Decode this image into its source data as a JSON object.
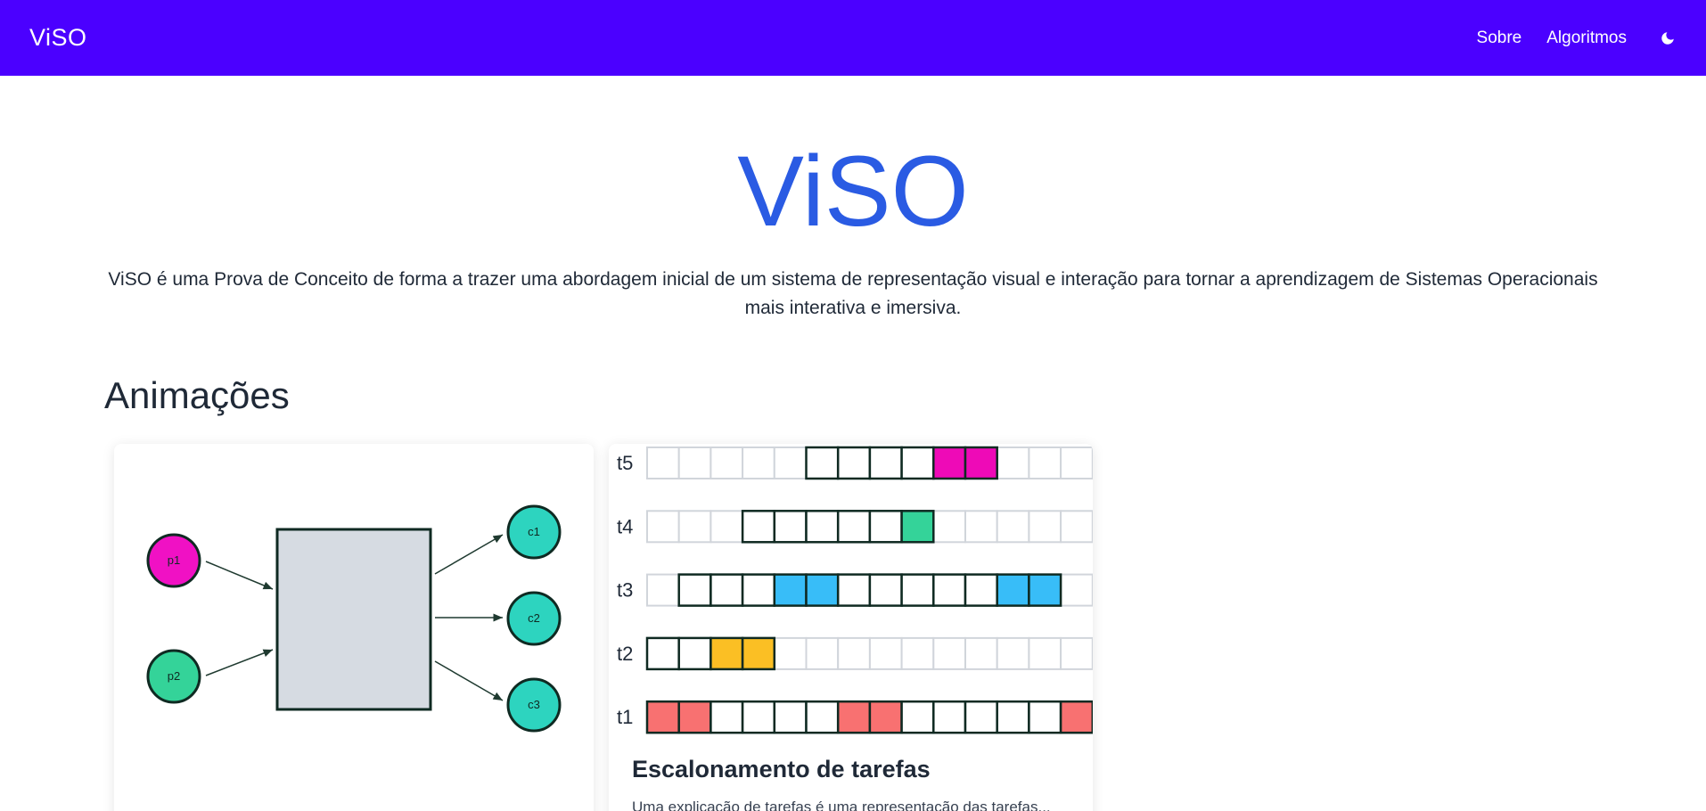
{
  "nav": {
    "brand": "ViSO",
    "links": [
      "Sobre",
      "Algoritmos"
    ],
    "theme_icon": "moon-icon"
  },
  "hero": {
    "title": "ViSO",
    "description": "ViSO é uma Prova de Conceito de forma a trazer uma abordagem inicial de um sistema de representação visual e interação para tornar a aprendizagem de Sistemas Operacionais mais interativa e imersiva."
  },
  "section": {
    "title": "Animações"
  },
  "producer_consumer": {
    "producers": [
      "p1",
      "p2"
    ],
    "consumers": [
      "c1",
      "c2",
      "c3"
    ],
    "colors": {
      "producer_p1": "#f011c4",
      "producer_p2": "#34d399",
      "consumer": "#2dd4bf",
      "buffer": "#d6dbe2"
    }
  },
  "scheduling": {
    "title": "Escalonamento de tarefas",
    "description": "Uma explicação de tarefas é uma representação das tarefas...",
    "rows": [
      {
        "label": "t5",
        "color": "#ee0ab7",
        "cells": [
          "e",
          "e",
          "e",
          "e",
          "e",
          "w",
          "w",
          "w",
          "w",
          "r",
          "r",
          "e",
          "e",
          "e"
        ]
      },
      {
        "label": "t4",
        "color": "#34d399",
        "cells": [
          "e",
          "e",
          "e",
          "w",
          "w",
          "w",
          "w",
          "w",
          "r",
          "e",
          "e",
          "e",
          "e",
          "e"
        ]
      },
      {
        "label": "t3",
        "color": "#38bdf8",
        "cells": [
          "e",
          "w",
          "w",
          "w",
          "r",
          "r",
          "w",
          "w",
          "w",
          "w",
          "w",
          "r",
          "r",
          "e"
        ]
      },
      {
        "label": "t2",
        "color": "#fbbf24",
        "cells": [
          "w",
          "w",
          "r",
          "r",
          "e",
          "e",
          "e",
          "e",
          "e",
          "e",
          "e",
          "e",
          "e",
          "e"
        ]
      },
      {
        "label": "t1",
        "color": "#f87171",
        "cells": [
          "r",
          "r",
          "w",
          "w",
          "w",
          "w",
          "r",
          "r",
          "w",
          "w",
          "w",
          "w",
          "w",
          "r"
        ]
      }
    ]
  }
}
